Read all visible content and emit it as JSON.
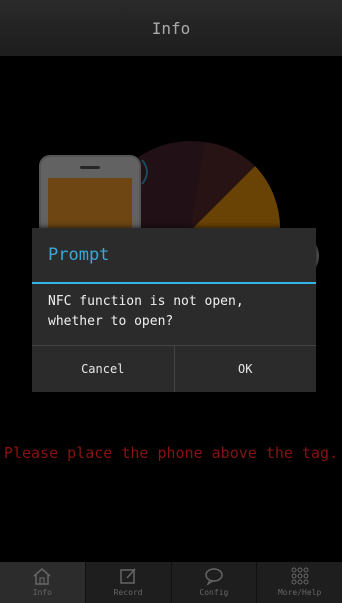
{
  "header": {
    "title": "Info"
  },
  "dialog": {
    "title": "Prompt",
    "message": "NFC function is not open, whether to open?",
    "cancel_label": "Cancel",
    "ok_label": "OK"
  },
  "hint": "Please place the phone above the tag.",
  "tabs": [
    {
      "label": "Info",
      "icon": "home-icon",
      "active": true
    },
    {
      "label": "Record",
      "icon": "edit-icon",
      "active": false
    },
    {
      "label": "Config",
      "icon": "chat-bubble-icon",
      "active": false
    },
    {
      "label": "More/Help",
      "icon": "grid-icon",
      "active": false
    }
  ],
  "colors": {
    "accent": "#33b5e5",
    "hint_text": "#8b1111",
    "pie_dark": "#4a2530",
    "pie_orange": "#e8960f"
  }
}
